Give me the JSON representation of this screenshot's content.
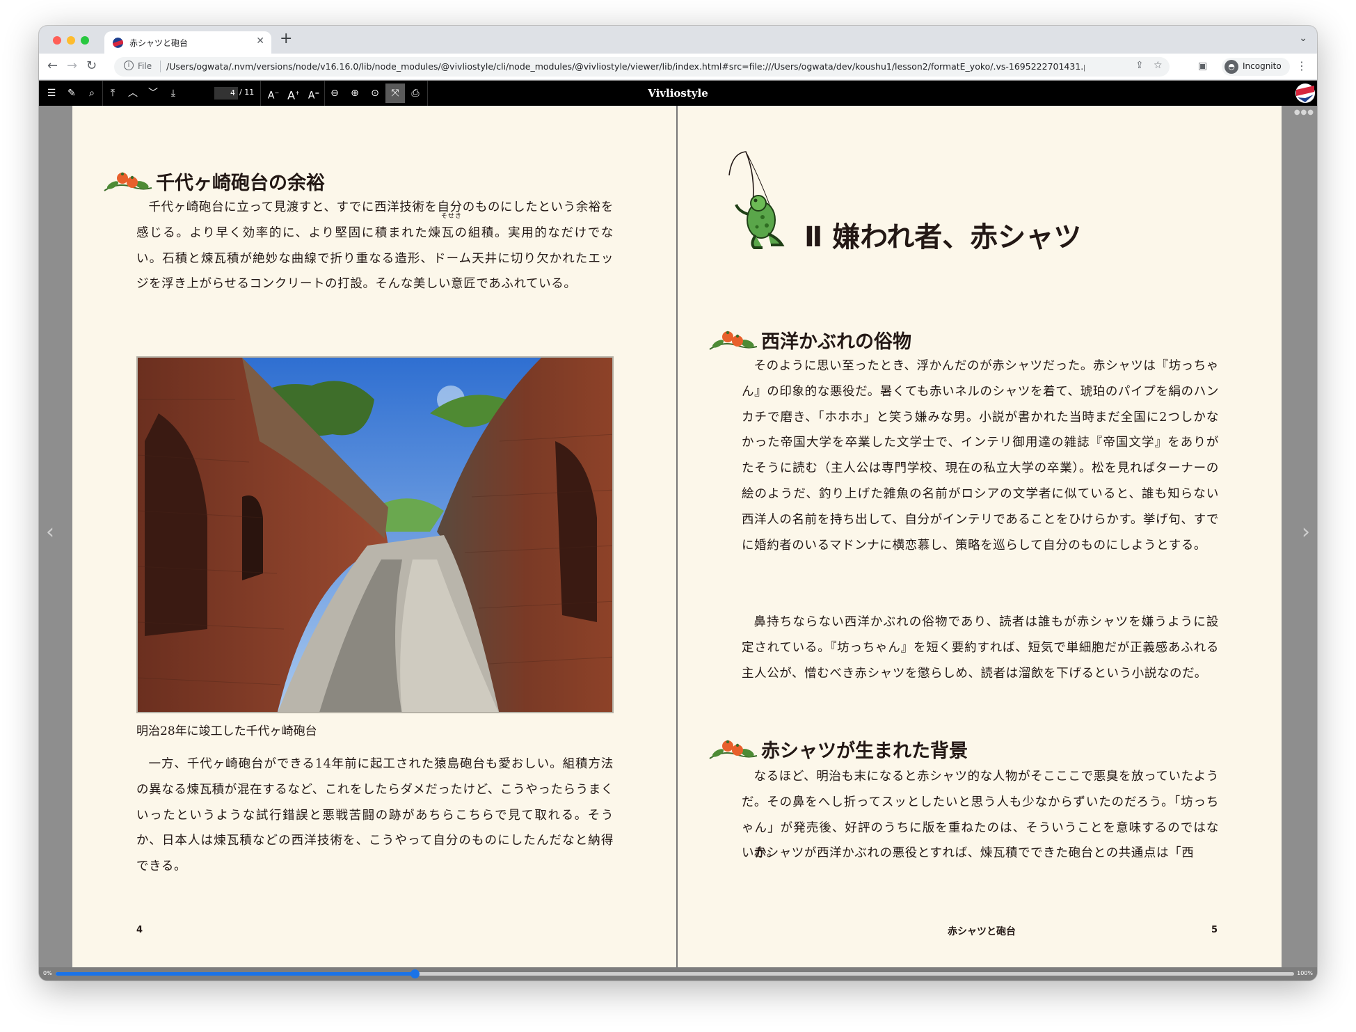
{
  "tab": {
    "title": "赤シャツと砲台",
    "close": "✕",
    "new": "+",
    "menu": "⌄"
  },
  "address": {
    "file_label": "File",
    "url": "/Users/ogwata/.nvm/versions/node/v16.16.0/lib/node_modules/@vivliostyle/cli/node_modules/@vivliostyle/viewer/lib/index.html#src=file:///Users/ogwata/dev/koushu1/lesson2/formatE_yoko/.vs-1695222701431.pu...",
    "profile": "Incognito"
  },
  "toolbar": {
    "page_current": "4",
    "page_total": "/ 11",
    "title": "Vivliostyle",
    "icons": [
      "toc-icon",
      "marker-icon",
      "search-icon",
      "first-page-icon",
      "prev-page-icon",
      "next-page-icon",
      "last-page-icon",
      "font-smaller-icon",
      "font-reset-icon",
      "font-larger-icon",
      "zoom-out-icon",
      "zoom-in-icon",
      "zoom-fit-icon",
      "fullscreen-icon",
      "print-icon"
    ],
    "accent": "#1a73e8"
  },
  "left_page": {
    "section_heading": "千代ヶ崎砲台の余裕",
    "para1": "千代ヶ崎砲台に立って見渡すと、すでに西洋技術を自分のものにしたという余裕を感じる。より早く効率的に、より堅固に積まれた煉瓦の組積。実用的なだけでない。石積と煉瓦積が絶妙な曲線で折り重なる造形、ドーム天井に切り欠かれたエッジを浮き上がらせるコンクリートの打設。そんな美しい意匠であふれている。",
    "ruby": "そせき",
    "caption": "明治28年に竣工した千代ヶ崎砲台",
    "para2": "一方、千代ヶ崎砲台ができる14年前に起工された猿島砲台も愛おしい。組積方法の異なる煉瓦積が混在するなど、これをしたらダメだったけど、こうやったらうまくいったというような試行錯誤と悪戦苦闘の跡があちらこちらで見て取れる。そうか、日本人は煉瓦積などの西洋技術を、こうやって自分のものにしたんだなと納得できる。",
    "folio": "4"
  },
  "right_page": {
    "chapter_title": "Ⅱ 嫌われ者、赤シャツ",
    "section1_heading": "西洋かぶれの俗物",
    "para1": "そのように思い至ったとき、浮かんだのが赤シャツだった。赤シャツは『坊っちゃん』の印象的な悪役だ。暑くても赤いネルのシャツを着て、琥珀のパイプを絹のハンカチで磨き、「ホホホ」と笑う嫌みな男。小説が書かれた当時まだ全国に2つしかなかった帝国大学を卒業した文学士で、インテリ御用達の雑誌『帝国文学』をありがたそうに読む（主人公は専門学校、現在の私立大学の卒業）。松を見ればターナーの絵のようだ、釣り上げた雑魚の名前がロシアの文学者に似ていると、誰も知らない西洋人の名前を持ち出して、自分がインテリであることをひけらかす。挙げ句、すでに婚約者のいるマドンナに横恋慕し、策略を巡らして自分のものにしようとする。",
    "para2": "鼻持ちならない西洋かぶれの俗物であり、読者は誰もが赤シャツを嫌うように設定されている。『坊っちゃん』を短く要約すれば、短気で単細胞だが正義感あふれる主人公が、憎むべき赤シャツを懲らしめ、読者は溜飲を下げるという小説なのだ。",
    "section2_heading": "赤シャツが生まれた背景",
    "para3": "なるほど、明治も末になると赤シャツ的な人物がそこここで悪臭を放っていたようだ。その鼻をへし折ってスッとしたいと思う人も少なからずいたのだろう。「坊っちゃん」が発売後、好評のうちに版を重ねたのは、そういうことを意味するのではないか。",
    "para4": "赤シャツが西洋かぶれの悪役とすれば、煉瓦積でできた砲台との共通点は「西",
    "running_head": "赤シャツと砲台",
    "folio": "5"
  },
  "progress": {
    "min_label": "0%",
    "max_label": "100%",
    "value": 0.29
  }
}
